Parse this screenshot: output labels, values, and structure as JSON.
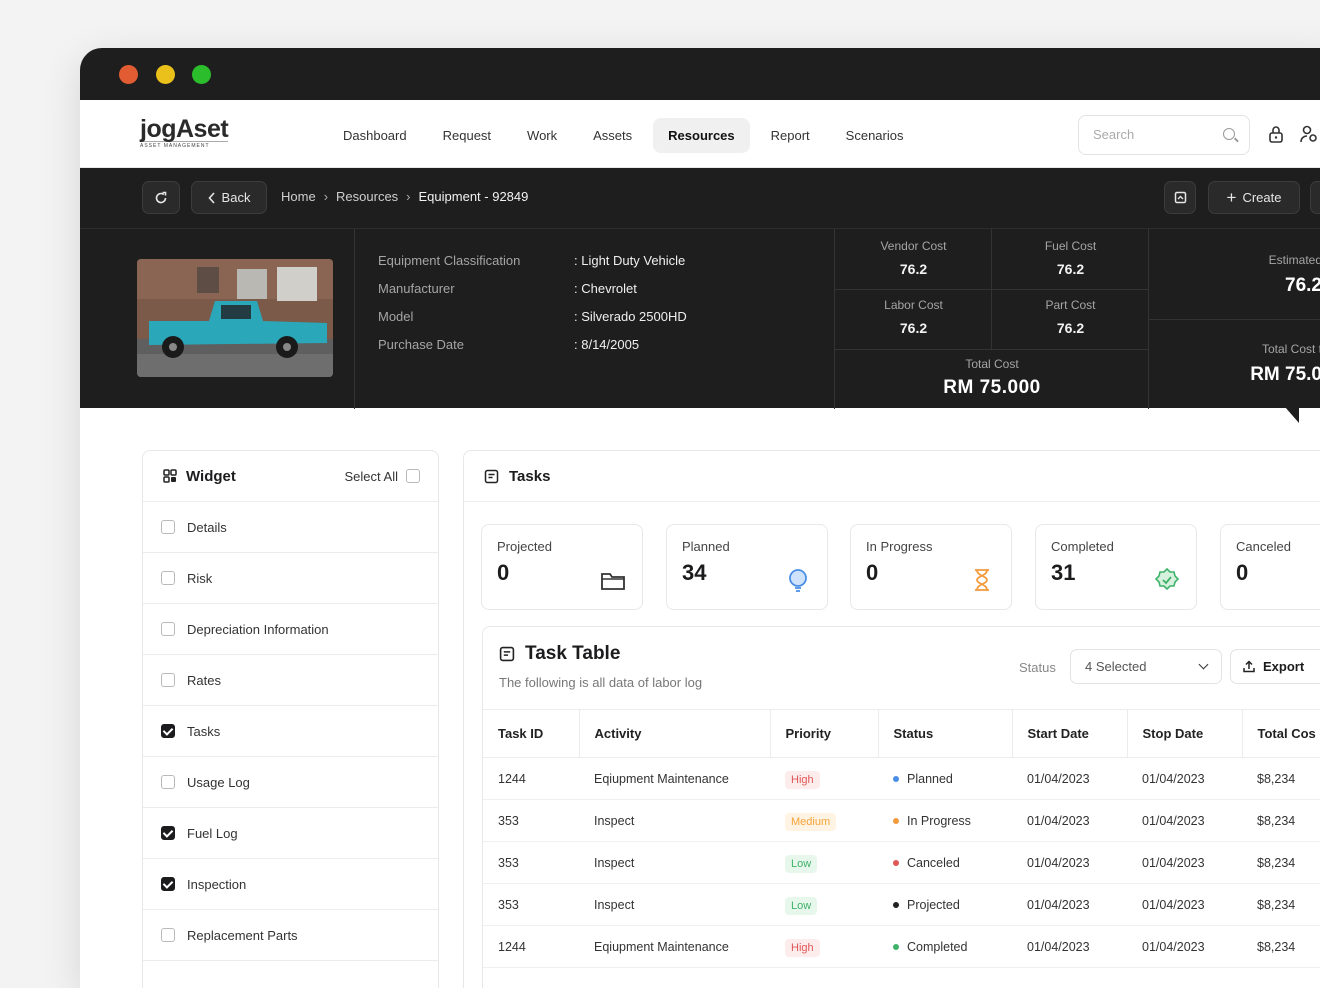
{
  "app": {
    "logo_main": "jogAset",
    "logo_sub": "ASSET MANAGEMENT"
  },
  "nav": {
    "links": [
      "Dashboard",
      "Request",
      "Work",
      "Assets",
      "Resources",
      "Report",
      "Scenarios"
    ],
    "active": "Resources",
    "search_placeholder": "Search"
  },
  "toolbar": {
    "back_label": "Back",
    "breadcrumb": [
      "Home",
      "Resources",
      "Equipment - 92849"
    ],
    "create_label": "Create"
  },
  "equipment": {
    "specs": [
      {
        "key": "Equipment Classification",
        "value": ": Light Duty Vehicle"
      },
      {
        "key": "Manufacturer",
        "value": ": Chevrolet"
      },
      {
        "key": "Model",
        "value": ": Silverado 2500HD"
      },
      {
        "key": "Purchase Date",
        "value": ": 8/14/2005"
      }
    ],
    "costs": {
      "vendor_label": "Vendor Cost",
      "vendor_value": "76.2",
      "fuel_label": "Fuel Cost",
      "fuel_value": "76.2",
      "labor_label": "Labor Cost",
      "labor_value": "76.2",
      "part_label": "Part Cost",
      "part_value": "76.2",
      "total_label": "Total Cost",
      "total_value": "RM 75.000"
    },
    "estimated_label": "Estimated",
    "estimated_value": "76.2",
    "total_cost_partial_label": "Total Cost t",
    "total_cost_partial_value": "RM 75.0"
  },
  "widget": {
    "title": "Widget",
    "select_all": "Select All",
    "items": [
      {
        "label": "Details",
        "checked": false
      },
      {
        "label": "Risk",
        "checked": false
      },
      {
        "label": "Depreciation Information",
        "checked": false
      },
      {
        "label": "Rates",
        "checked": false
      },
      {
        "label": "Tasks",
        "checked": true
      },
      {
        "label": "Usage Log",
        "checked": false
      },
      {
        "label": "Fuel Log",
        "checked": true
      },
      {
        "label": "Inspection",
        "checked": true
      },
      {
        "label": "Replacement Parts",
        "checked": false
      }
    ]
  },
  "tasks": {
    "title": "Tasks",
    "stats": [
      {
        "label": "Projected",
        "value": "0",
        "icon": "folder-icon",
        "color": "#333333"
      },
      {
        "label": "Planned",
        "value": "34",
        "icon": "lightbulb-icon",
        "color": "#4a8fe7"
      },
      {
        "label": "In Progress",
        "value": "0",
        "icon": "hourglass-icon",
        "color": "#f39a3c"
      },
      {
        "label": "Completed",
        "value": "31",
        "icon": "verified-icon",
        "color": "#3fb36a"
      },
      {
        "label": "Canceled",
        "value": "0",
        "icon": "cancel-icon",
        "color": "#e05757"
      }
    ],
    "table_title": "Task Table",
    "table_subtitle": "The following is all data of labor log",
    "status_label": "Status",
    "status_value": "4 Selected",
    "export_label": "Export",
    "columns": [
      "Task ID",
      "Activity",
      "Priority",
      "Status",
      "Start Date",
      "Stop Date",
      "Total Cos"
    ],
    "rows": [
      {
        "id": "1244",
        "activity": "Eqiupment Maintenance",
        "priority": "High",
        "status": "Planned",
        "status_color": "#4a8fe7",
        "start": "01/04/2023",
        "stop": "01/04/2023",
        "total": "$8,234"
      },
      {
        "id": "353",
        "activity": "Inspect",
        "priority": "Medium",
        "status": "In Progress",
        "status_color": "#f39a3c",
        "start": "01/04/2023",
        "stop": "01/04/2023",
        "total": "$8,234"
      },
      {
        "id": "353",
        "activity": "Inspect",
        "priority": "Low",
        "status": "Canceled",
        "status_color": "#e05757",
        "start": "01/04/2023",
        "stop": "01/04/2023",
        "total": "$8,234"
      },
      {
        "id": "353",
        "activity": "Inspect",
        "priority": "Low",
        "status": "Projected",
        "status_color": "#222222",
        "start": "01/04/2023",
        "stop": "01/04/2023",
        "total": "$8,234"
      },
      {
        "id": "1244",
        "activity": "Eqiupment Maintenance",
        "priority": "High",
        "status": "Completed",
        "status_color": "#3fb36a",
        "start": "01/04/2023",
        "stop": "01/04/2023",
        "total": "$8,234"
      }
    ]
  }
}
